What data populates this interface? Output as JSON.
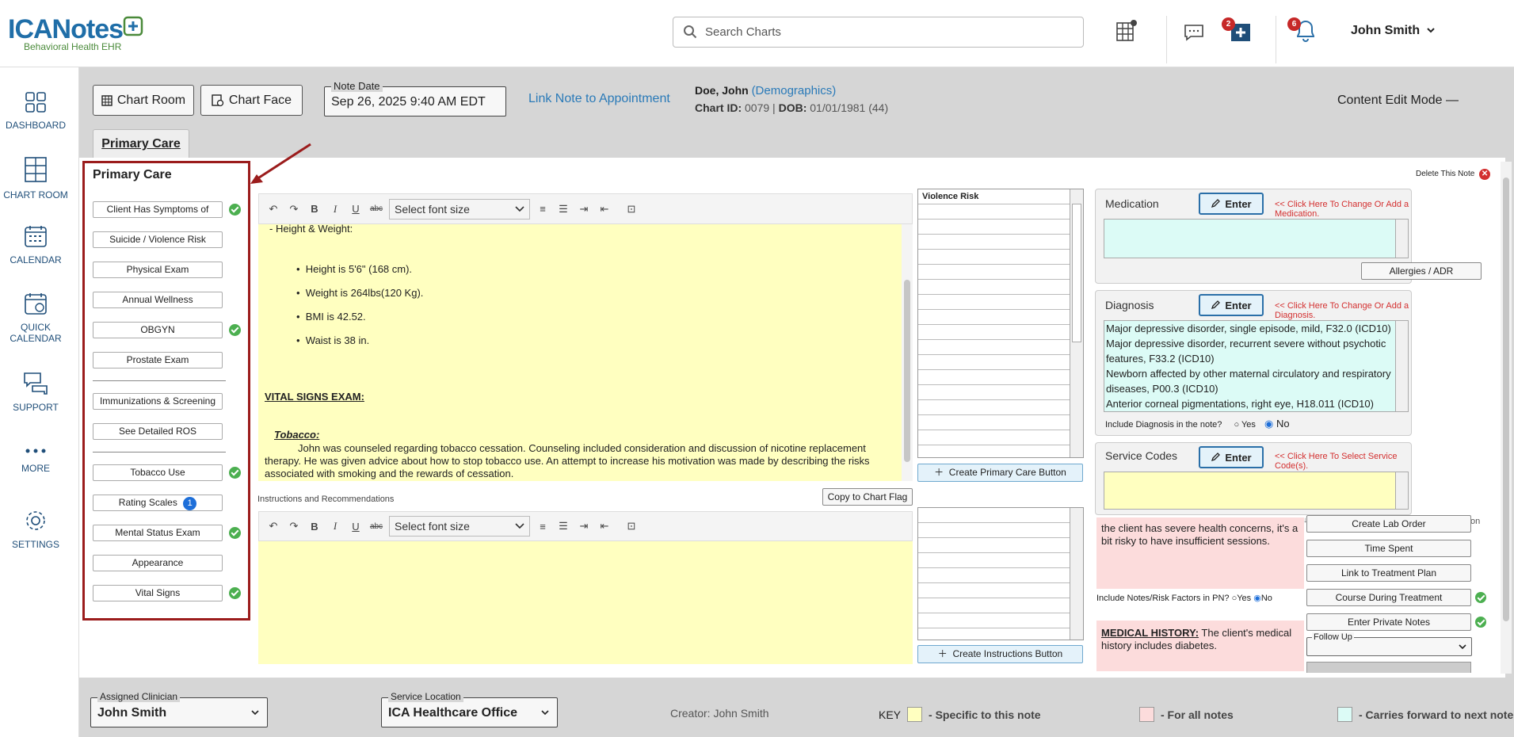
{
  "header": {
    "logo_text": "ICANotes",
    "logo_sub": "Behavioral Health EHR",
    "search_placeholder": "Search Charts",
    "msg_badge": "2",
    "bell_badge": "6",
    "user_name": "John Smith"
  },
  "nav": [
    {
      "label": "DASHBOARD"
    },
    {
      "label": "CHART ROOM"
    },
    {
      "label": "CALENDAR"
    },
    {
      "label": "QUICK CALENDAR"
    },
    {
      "label": "SUPPORT"
    },
    {
      "label": "MORE"
    },
    {
      "label": "SETTINGS"
    }
  ],
  "toolbar": {
    "chart_room": "Chart Room",
    "chart_face": "Chart Face",
    "note_date_label": "Note Date",
    "note_date": "Sep 26, 2025 9:40 AM EDT",
    "link_note": "Link Note to Appointment",
    "patient_name": "Doe, John",
    "demographics": "(Demographics)",
    "chart_id_label": "Chart ID:",
    "chart_id": "0079",
    "dob_label": "DOB:",
    "dob": "01/01/1981 (44)",
    "content_edit": "Content Edit Mode",
    "content_edit_sym": "—"
  },
  "tab": {
    "label": "Primary Care"
  },
  "left_panel": {
    "title": "Primary Care",
    "items": [
      "Client Has Symptoms of",
      "Suicide / Violence Risk",
      "Physical Exam",
      "Annual Wellness",
      "OBGYN",
      "Prostate Exam",
      "Immunizations & Screening",
      "See Detailed ROS",
      "Tobacco Use",
      "Rating Scales",
      "Mental Status Exam",
      "Appearance",
      "Vital Signs"
    ],
    "rating_badge": "1"
  },
  "editor1": {
    "font_size_placeholder": "Select font size",
    "line1": "- Height & Weight:",
    "bullets": [
      "Height is 5'6\" (168 cm).",
      "Weight is 264lbs(120 Kg).",
      "BMI is 42.52.",
      "Waist is 38 in."
    ],
    "heading": "VITAL SIGNS EXAM:",
    "sub": "Tobacco:",
    "para": "John was counseled regarding tobacco cessation. Counseling included consideration and discussion of nicotine replacement therapy. He was given advice about how to stop tobacco use. An attempt to increase his motivation was made by describing the risks associated with smoking and the rewards of cessation."
  },
  "editor2": {
    "label": "Instructions and Recommendations",
    "copy_flag": "Copy to Chart Flag",
    "font_size_placeholder": "Select font size"
  },
  "grid1": {
    "header": "Violence Risk",
    "button": "Create Primary Care Button"
  },
  "grid2": {
    "button": "Create Instructions Button"
  },
  "delete_note": "Delete This Note",
  "medication": {
    "title": "Medication",
    "enter": "Enter",
    "hint": "<< Click Here To Change Or Add a Medication.",
    "allergies": "Allergies / ADR"
  },
  "diagnosis": {
    "title": "Diagnosis",
    "enter": "Enter",
    "hint": "<< Click Here To Change Or Add a Diagnosis.",
    "items": [
      "Major depressive disorder, single episode, mild, F32.0 (ICD10)",
      "Major depressive disorder, recurrent severe without psychotic features, F33.2 (ICD10)",
      "Newborn affected by other maternal circulatory and respiratory diseases, P00.3 (ICD10)",
      "Anterior corneal pigmentations, right eye, H18.011 (ICD10)"
    ],
    "include_label": "Include Diagnosis in the note?",
    "yes": "Yes",
    "no": "No"
  },
  "service": {
    "title": "Service Codes",
    "enter": "Enter",
    "hint": "<< Click Here To Select Service Code(s)."
  },
  "risk": {
    "text": "the client has severe health concerns, it's a bit risky to have insufficient sessions.",
    "include_label": "Include Notes/Risk Factors in PN?",
    "yes": "Yes",
    "no": "No",
    "cut_text": "on"
  },
  "medical_history": {
    "label": "MEDICAL HISTORY:",
    "text": "The client's medical history includes diabetes."
  },
  "actions": [
    "Create Lab Order",
    "Time Spent",
    "Link to Treatment Plan",
    "Course During Treatment",
    "Enter Private Notes"
  ],
  "follow_up": "Follow Up",
  "footer": {
    "clinician_label": "Assigned Clinician",
    "clinician": "John Smith",
    "location_label": "Service Location",
    "location": "ICA Healthcare Office",
    "creator": "Creator: John Smith",
    "key": "KEY",
    "key1": "- Specific to this note",
    "key2": "- For all notes",
    "key3": "- Carries forward to next note",
    "c1": "#ffffc0",
    "c2": "#fcdcdc",
    "c3": "#dcfbf6"
  }
}
